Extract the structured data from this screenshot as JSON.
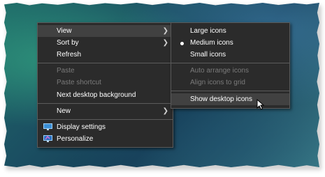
{
  "main_menu": {
    "items": [
      {
        "label": "View",
        "submenu": true
      },
      {
        "label": "Sort by",
        "submenu": true
      },
      {
        "label": "Refresh"
      },
      {
        "label": "Paste",
        "disabled": true
      },
      {
        "label": "Paste shortcut",
        "disabled": true
      },
      {
        "label": "Next desktop background"
      },
      {
        "label": "New",
        "submenu": true
      },
      {
        "label": "Display settings",
        "icon": "display-settings-icon"
      },
      {
        "label": "Personalize",
        "icon": "personalize-icon"
      }
    ]
  },
  "view_submenu": {
    "items": [
      {
        "label": "Large icons"
      },
      {
        "label": "Medium icons",
        "selected": true
      },
      {
        "label": "Small icons"
      },
      {
        "label": "Auto arrange icons",
        "disabled": true
      },
      {
        "label": "Align icons to grid",
        "disabled": true
      },
      {
        "label": "Show desktop icons",
        "hovered": true
      }
    ]
  },
  "colors": {
    "menu_bg": "#2b2b2b",
    "hover_bg": "#414141",
    "disabled_text": "#7a7a7a"
  }
}
